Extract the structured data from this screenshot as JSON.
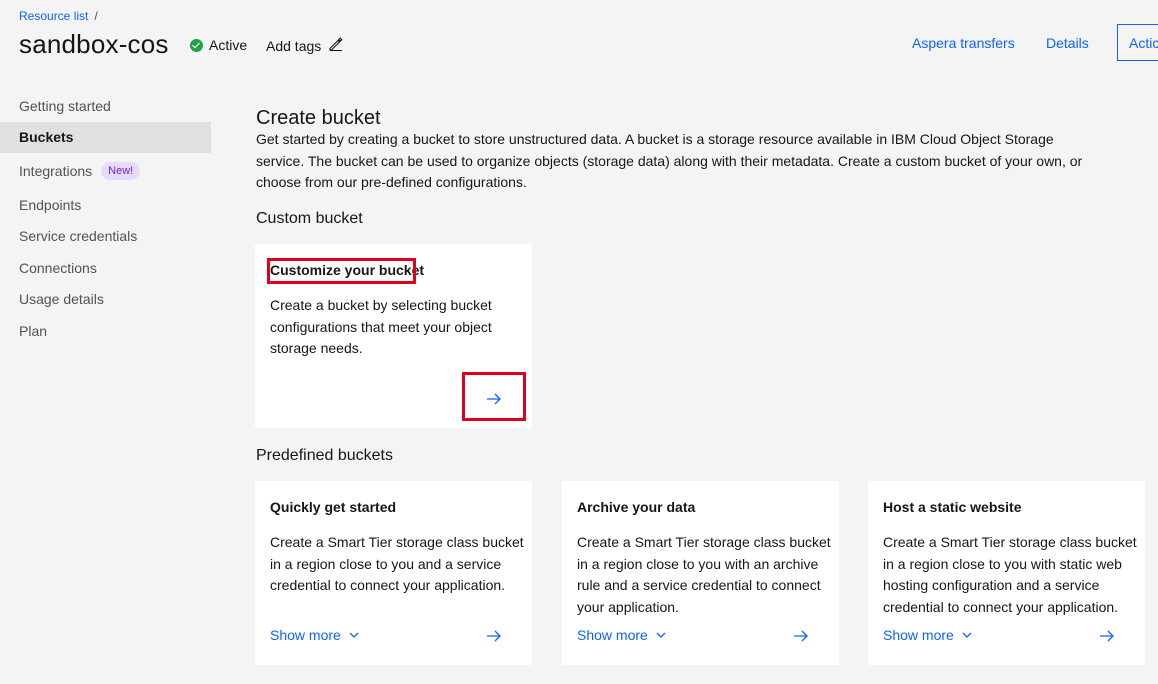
{
  "header": {
    "breadcrumb": "Resource list",
    "breadcrumb_sep": "/",
    "title": "sandbox-cos",
    "status": "Active",
    "add_tags": "Add tags",
    "links": [
      "Aspera transfers",
      "Details"
    ],
    "actions_label": "Actic"
  },
  "sidebar": {
    "items": [
      {
        "label": "Getting started"
      },
      {
        "label": "Buckets",
        "active": true
      },
      {
        "label": "Integrations",
        "badge": "New!"
      },
      {
        "label": "Endpoints"
      },
      {
        "label": "Service credentials"
      },
      {
        "label": "Connections"
      },
      {
        "label": "Usage details"
      },
      {
        "label": "Plan"
      }
    ]
  },
  "main": {
    "title": "Create bucket",
    "description": "Get started by creating a bucket to store unstructured data. A bucket is a storage resource available in IBM Cloud Object Storage service. The bucket can be used to organize objects (storage data) along with their metadata. Create a custom bucket of your own, or choose from our pre-defined configurations.",
    "custom_section": "Custom bucket",
    "custom_tile": {
      "title": "Customize your bucket",
      "text": "Create a bucket by selecting bucket configurations that meet your object storage needs."
    },
    "predefined_section": "Predefined buckets",
    "predefined_tiles": [
      {
        "title": "Quickly get started",
        "text": "Create a Smart Tier storage class bucket in a region close to you and a service credential to connect your application.",
        "show_more": "Show more"
      },
      {
        "title": "Archive your data",
        "text": "Create a Smart Tier storage class bucket in a region close to you with an archive rule and a service credential to connect your application.",
        "show_more": "Show more"
      },
      {
        "title": "Host a static website",
        "text": "Create a Smart Tier storage class bucket in a region close to you with static web hosting configuration and a service credential to connect your application.",
        "show_more": "Show more"
      }
    ]
  },
  "colors": {
    "link": "#0f62fe",
    "status_green": "#24a148",
    "highlight_red": "#e0001b",
    "badge_bg": "#e8daff"
  }
}
